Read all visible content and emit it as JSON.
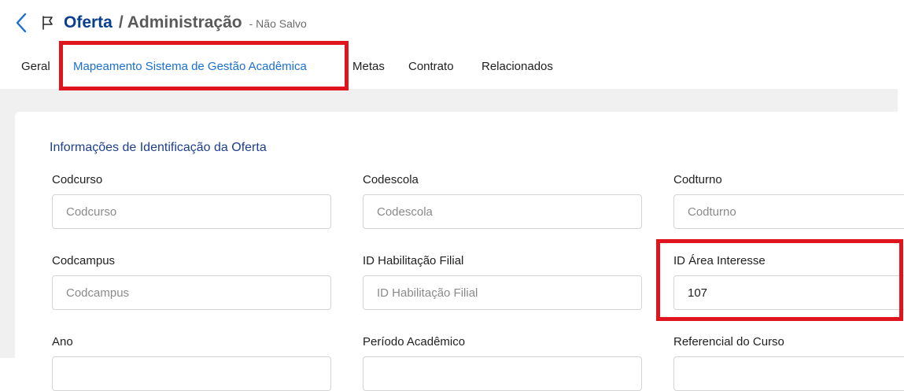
{
  "header": {
    "title": "Oferta",
    "subtitle": "/ Administração",
    "status": "- Não Salvo"
  },
  "tabs": [
    {
      "label": "Geral",
      "active": false
    },
    {
      "label": "Mapeamento Sistema de Gestão Acadêmica",
      "active": true
    },
    {
      "label": "Metas",
      "active": false
    },
    {
      "label": "Contrato",
      "active": false
    },
    {
      "label": "Relacionados",
      "active": false
    }
  ],
  "section": {
    "title": "Informações de Identificação da Oferta"
  },
  "fields": [
    {
      "label": "Codcurso",
      "placeholder": "Codcurso",
      "value": ""
    },
    {
      "label": "Codescola",
      "placeholder": "Codescola",
      "value": ""
    },
    {
      "label": "Codturno",
      "placeholder": "Codturno",
      "value": ""
    },
    {
      "label": "Codcampus",
      "placeholder": "Codcampus",
      "value": ""
    },
    {
      "label": "ID Habilitação Filial",
      "placeholder": "ID Habilitação Filial",
      "value": ""
    },
    {
      "label": "ID Área Interesse",
      "placeholder": "",
      "value": "107"
    },
    {
      "label": "Ano",
      "placeholder": "",
      "value": ""
    },
    {
      "label": "Período Acadêmico",
      "placeholder": "",
      "value": ""
    },
    {
      "label": "Referencial do Curso",
      "placeholder": "",
      "value": ""
    }
  ],
  "colors": {
    "accent": "#1a6fd4",
    "title": "#0a3e8f",
    "highlight": "#e0141c",
    "canvas": "#f0f0f0"
  },
  "icons": {
    "back": "chevron-left-icon",
    "flag": "flag-icon"
  }
}
